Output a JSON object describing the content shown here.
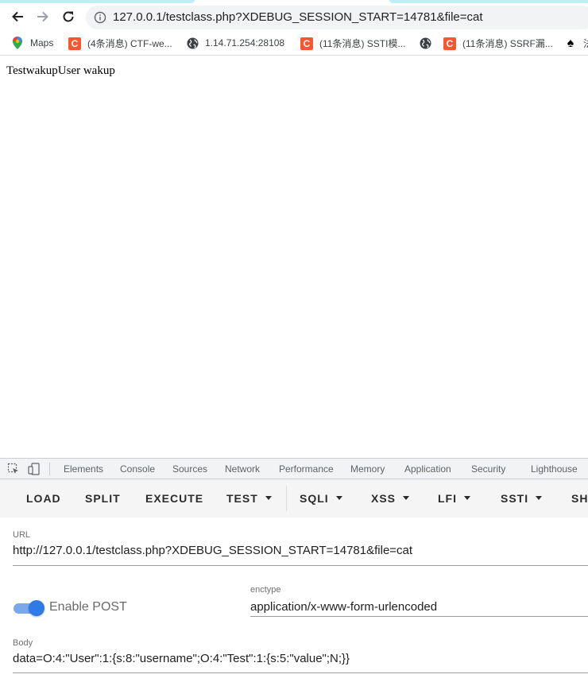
{
  "browser": {
    "url_display": "127.0.0.1/testclass.php?XDEBUG_SESSION_START=14781&file=cat",
    "icons": {
      "back": "back-arrow-icon",
      "forward": "forward-arrow-icon",
      "reload": "reload-icon",
      "site_info": "info-icon"
    }
  },
  "bookmarks": [
    {
      "label": "Maps",
      "icon": "maps-pin-icon"
    },
    {
      "label": "(4条消息) CTF-we...",
      "icon": "csdn-icon"
    },
    {
      "label": "1.14.71.254:28108",
      "icon": "globe-icon"
    },
    {
      "label": "(11条消息) SSTI模...",
      "icon": "csdn-icon"
    },
    {
      "label": "",
      "icon": "globe-icon"
    },
    {
      "label": "(11条消息) SSRF漏...",
      "icon": "csdn-icon"
    },
    {
      "label": "法",
      "icon": "spade-icon"
    }
  ],
  "page": {
    "output_text": "TestwakupUser wakup"
  },
  "devtools": {
    "tabs": [
      "Elements",
      "Console",
      "Sources",
      "Network",
      "Performance",
      "Memory",
      "Application",
      "Security",
      "Lighthouse"
    ]
  },
  "hackbar": {
    "buttons": [
      {
        "label": "LOAD"
      },
      {
        "label": "SPLIT"
      },
      {
        "label": "EXECUTE"
      },
      {
        "label": "TEST"
      },
      {
        "label": "SQLI"
      },
      {
        "label": "XSS"
      },
      {
        "label": "LFI"
      },
      {
        "label": "SSTI"
      },
      {
        "label": "SH"
      }
    ],
    "url_label": "URL",
    "url_value": "http://127.0.0.1/testclass.php?XDEBUG_SESSION_START=14781&file=cat",
    "enable_post_label": "Enable POST",
    "enable_post_on": true,
    "enctype_label": "enctype",
    "enctype_value": "application/x-www-form-urlencoded",
    "body_label": "Body",
    "body_value": "data=O:4:\"User\":1:{s:8:\"username\";O:4:\"Test\":1:{s:5:\"value\";N;}}",
    "accent_color": "#2e7be6"
  }
}
